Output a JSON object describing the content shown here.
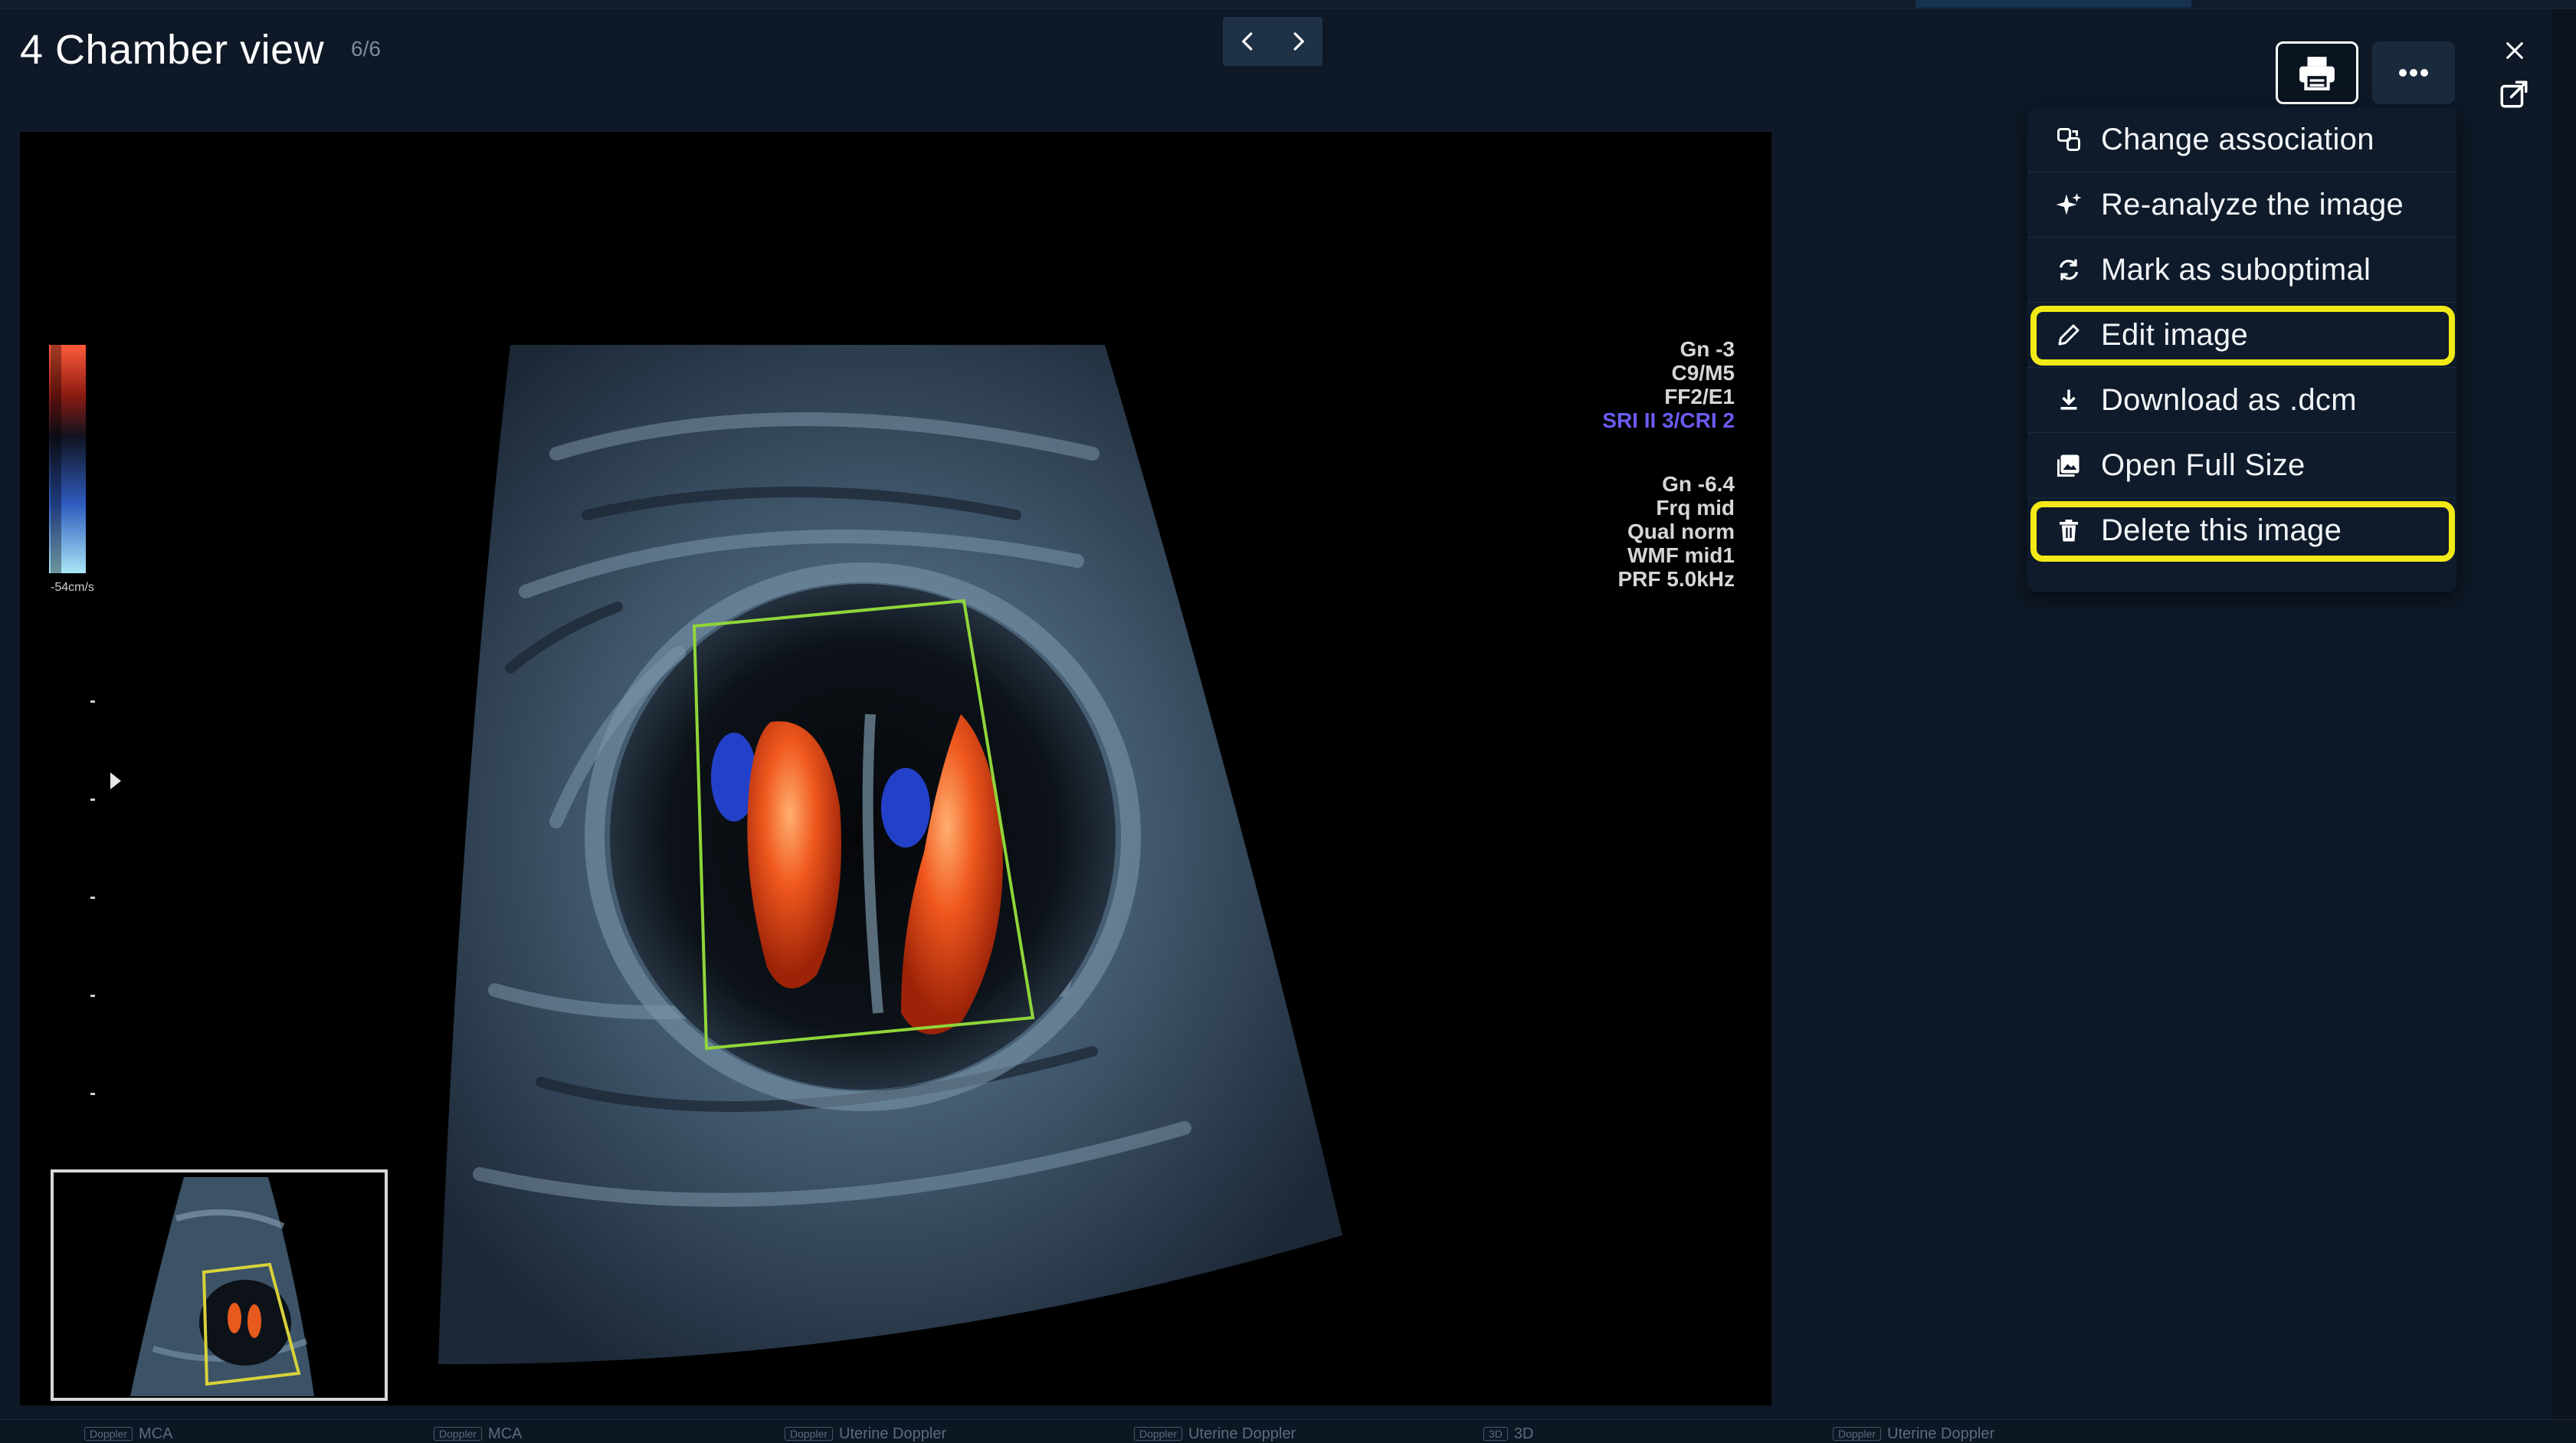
{
  "header": {
    "title": "4 Chamber view",
    "counter": "6/6",
    "prev_icon": "chevron-left-icon",
    "next_icon": "chevron-right-icon",
    "print_icon": "printer-icon",
    "more_icon": "more-horizontal-icon",
    "close_icon": "close-icon",
    "popout_icon": "open-external-icon"
  },
  "ultrasound": {
    "overlay_top": [
      "Gn -3",
      "C9/M5",
      "FF2/E1"
    ],
    "overlay_accent": "SRI II 3/CRI 2",
    "overlay_bottom": [
      "Gn -6.4",
      "Frq mid",
      "Qual norm",
      "WMF mid1",
      "PRF  5.0kHz"
    ],
    "scale_label": "-54cm/s"
  },
  "menu": {
    "items": [
      {
        "label": "Change association",
        "icon": "change-association-icon",
        "highlight": false
      },
      {
        "label": "Re-analyze the image",
        "icon": "sparkle-icon",
        "highlight": false
      },
      {
        "label": "Mark as suboptimal",
        "icon": "refresh-icon",
        "highlight": false
      },
      {
        "label": "Edit image",
        "icon": "pencil-icon",
        "highlight": true
      },
      {
        "label": "Download as .dcm",
        "icon": "download-icon",
        "highlight": false
      },
      {
        "label": "Open Full Size",
        "icon": "image-icon",
        "highlight": false
      },
      {
        "label": "Delete this image",
        "icon": "trash-icon",
        "highlight": true
      }
    ]
  },
  "bottom_tabs": [
    {
      "tag": "Doppler",
      "label": "MCA"
    },
    {
      "tag": "Doppler",
      "label": "MCA"
    },
    {
      "tag": "Doppler",
      "label": "Uterine Doppler"
    },
    {
      "tag": "Doppler",
      "label": "Uterine Doppler"
    },
    {
      "tag": "3D",
      "label": "3D"
    },
    {
      "tag": "Doppler",
      "label": "Uterine Doppler"
    }
  ],
  "colors": {
    "highlight": "#f2ea17",
    "roi_box": "#8fd63a",
    "accent_text": "#6a5cf0"
  }
}
